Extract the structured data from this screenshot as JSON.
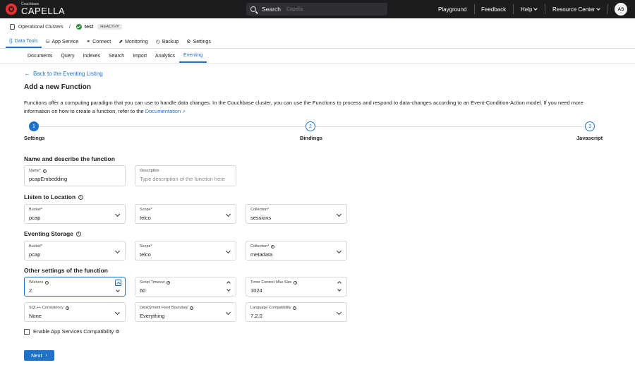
{
  "topbar": {
    "logo_small": "Couchbase",
    "logo_big": "CAPELLA",
    "search_label": "Search",
    "search_placeholder": "Capella",
    "nav": {
      "playground": "Playground",
      "feedback": "Feedback",
      "help": "Help",
      "resource_center": "Resource Center"
    },
    "avatar": "AS"
  },
  "breadcrumb": {
    "root": "Operational Clusters",
    "separator": "/",
    "cluster": "test",
    "status": "HEALTHY"
  },
  "main_tabs": [
    {
      "label": "Data Tools",
      "icon": "{}",
      "active": true
    },
    {
      "label": "App Service",
      "icon": "⛁"
    },
    {
      "label": "Connect",
      "icon": "⚭"
    },
    {
      "label": "Monitoring",
      "icon": "⬈"
    },
    {
      "label": "Backup",
      "icon": "◷"
    },
    {
      "label": "Settings",
      "icon": "⚙"
    }
  ],
  "sub_tabs": [
    {
      "label": "Documents"
    },
    {
      "label": "Query"
    },
    {
      "label": "Indexes"
    },
    {
      "label": "Search"
    },
    {
      "label": "Import"
    },
    {
      "label": "Analytics"
    },
    {
      "label": "Eventing",
      "active": true
    }
  ],
  "page": {
    "back_link": "Back to the Eventing Listing",
    "title": "Add a new Function",
    "description": "Functions offer a computing paradigm that you can use to handle data changes. In the Couchbase cluster, you can use the Functions to process and respond to data-changes according to an Event-Condition-Action model. If you need more information on how to create a function, refer to the ",
    "description_link": "Documentation"
  },
  "steps": [
    {
      "num": "1",
      "label": "Settings",
      "active": true
    },
    {
      "num": "2",
      "label": "Bindings"
    },
    {
      "num": "3",
      "label": "Javascript"
    }
  ],
  "sections": {
    "name_describe": "Name and describe the function",
    "listen": "Listen to Location",
    "storage": "Eventing Storage",
    "other": "Other settings of the function"
  },
  "fields": {
    "name": {
      "label": "Name*",
      "value": "pcapEmbedding"
    },
    "description": {
      "label": "Description",
      "placeholder": "Type description of the function here"
    },
    "listen_bucket": {
      "label": "Bucket*",
      "value": "pcap"
    },
    "listen_scope": {
      "label": "Scope*",
      "value": "telco"
    },
    "listen_collection": {
      "label": "Collection*",
      "value": "sessions"
    },
    "storage_bucket": {
      "label": "Bucket*",
      "value": "pcap"
    },
    "storage_scope": {
      "label": "Scope*",
      "value": "telco"
    },
    "storage_collection": {
      "label": "Collection*",
      "value": "metadata"
    },
    "workers": {
      "label": "Workers",
      "value": "2"
    },
    "script_timeout": {
      "label": "Script Timeout",
      "value": "60"
    },
    "timer_context": {
      "label": "Timer Context Max Size",
      "value": "1024"
    },
    "sql_consistency": {
      "label": "SQL++ Consistency",
      "value": "None"
    },
    "feed_boundary": {
      "label": "Deployment Feed Boundary",
      "value": "Everything"
    },
    "language_compat": {
      "label": "Language Compatibility",
      "value": "7.2.0"
    }
  },
  "checkbox": {
    "label": "Enable App Services Compatibility",
    "checked": false
  },
  "next_button": "Next",
  "colors": {
    "accent": "#1e73c8",
    "topbar": "#1c1c1f",
    "brand_red": "#e8302d",
    "healthy": "#2e8b3a"
  }
}
